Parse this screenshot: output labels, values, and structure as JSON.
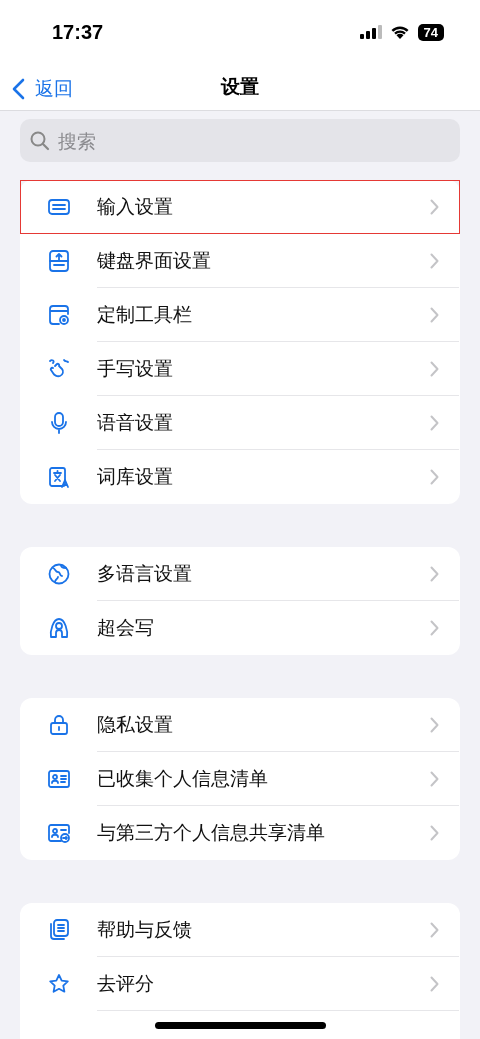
{
  "status_bar": {
    "time": "17:37",
    "battery": "74"
  },
  "nav": {
    "back": "返回",
    "title": "设置"
  },
  "search": {
    "placeholder": "搜索"
  },
  "groups": [
    {
      "items": [
        {
          "label": "输入设置",
          "highlighted": true
        },
        {
          "label": "键盘界面设置",
          "highlighted": false
        },
        {
          "label": "定制工具栏",
          "highlighted": false
        },
        {
          "label": "手写设置",
          "highlighted": false
        },
        {
          "label": "语音设置",
          "highlighted": false
        },
        {
          "label": "词库设置",
          "highlighted": false
        }
      ]
    },
    {
      "items": [
        {
          "label": "多语言设置",
          "highlighted": false
        },
        {
          "label": "超会写",
          "highlighted": false
        }
      ]
    },
    {
      "items": [
        {
          "label": "隐私设置",
          "highlighted": false
        },
        {
          "label": "已收集个人信息清单",
          "highlighted": false
        },
        {
          "label": "与第三方个人信息共享清单",
          "highlighted": false
        }
      ]
    },
    {
      "items": [
        {
          "label": "帮助与反馈",
          "highlighted": false
        },
        {
          "label": "去评分",
          "highlighted": false
        }
      ]
    }
  ]
}
